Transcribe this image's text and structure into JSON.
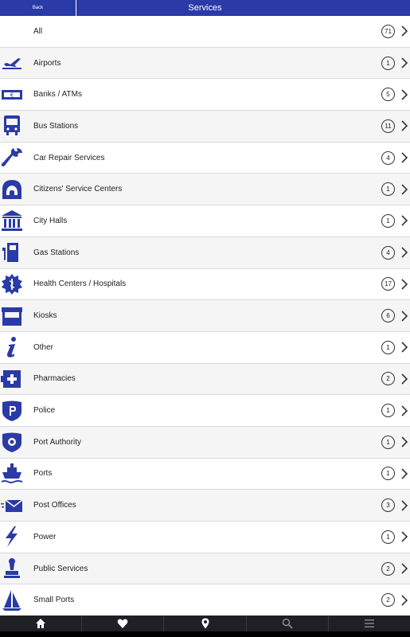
{
  "header": {
    "back_label": "Back",
    "title": "Services"
  },
  "items": [
    {
      "label": "All",
      "count": "71",
      "icon": "none"
    },
    {
      "label": "Airports",
      "count": "1",
      "icon": "plane-icon"
    },
    {
      "label": "Banks / ATMs",
      "count": "5",
      "icon": "banknote-icon"
    },
    {
      "label": "Bus Stations",
      "count": "11",
      "icon": "bus-icon"
    },
    {
      "label": "Car Repair Services",
      "count": "4",
      "icon": "wrench-icon"
    },
    {
      "label": "Citizens' Service Centers",
      "count": "1",
      "icon": "phone-icon"
    },
    {
      "label": "City Halls",
      "count": "1",
      "icon": "city-hall-icon"
    },
    {
      "label": "Gas Stations",
      "count": "4",
      "icon": "fuel-pump-icon"
    },
    {
      "label": "Health Centers / Hospitals",
      "count": "17",
      "icon": "medical-icon"
    },
    {
      "label": "Kiosks",
      "count": "6",
      "icon": "kiosk-icon"
    },
    {
      "label": "Other",
      "count": "1",
      "icon": "info-icon"
    },
    {
      "label": "Pharmacies",
      "count": "2",
      "icon": "pharmacy-icon"
    },
    {
      "label": "Police",
      "count": "1",
      "icon": "police-icon"
    },
    {
      "label": "Port Authority",
      "count": "1",
      "icon": "port-authority-icon"
    },
    {
      "label": "Ports",
      "count": "1",
      "icon": "ship-icon"
    },
    {
      "label": "Post Offices",
      "count": "3",
      "icon": "mail-icon"
    },
    {
      "label": "Power",
      "count": "1",
      "icon": "lightning-icon"
    },
    {
      "label": "Public Services",
      "count": "2",
      "icon": "stamp-icon"
    },
    {
      "label": "Small Ports",
      "count": "2",
      "icon": "sailboat-icon"
    }
  ],
  "tabbar": [
    "home-icon",
    "heart-icon",
    "location-pin-icon",
    "search-icon",
    "menu-icon"
  ],
  "colors": {
    "accent": "#2a3aa6",
    "tabbar": "#1f2024"
  }
}
